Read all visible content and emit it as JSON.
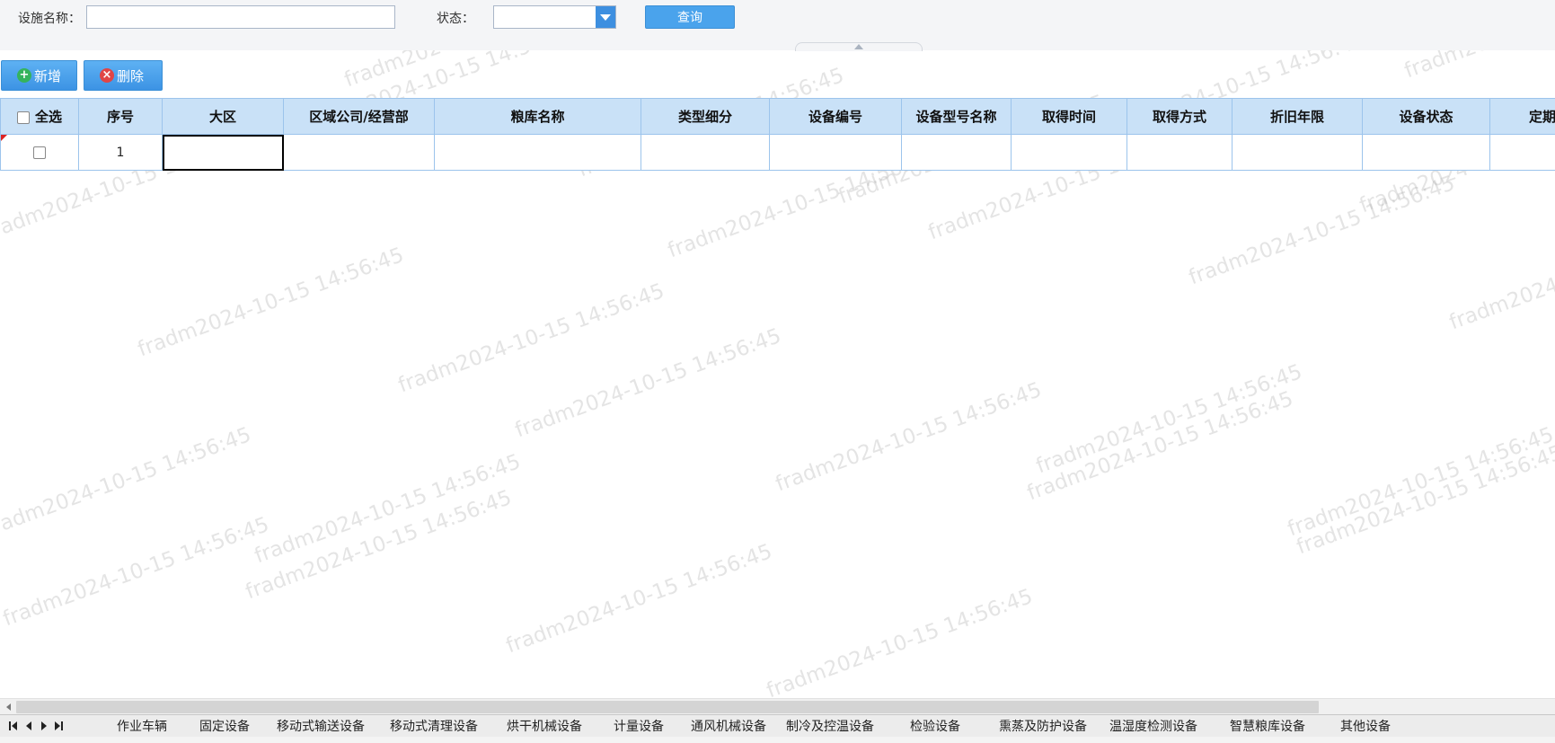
{
  "query": {
    "name_label": "设施名称：",
    "name_value": "",
    "status_label": "状态：",
    "status_value": "",
    "query_button": "查询"
  },
  "toolbar": {
    "add_label": "新增",
    "delete_label": "删除"
  },
  "grid": {
    "select_all_label": "全选",
    "columns": [
      "序号",
      "大区",
      "区域公司/经营部",
      "粮库名称",
      "类型细分",
      "设备编号",
      "设备型号名称",
      "取得时间",
      "取得方式",
      "折旧年限",
      "设备状态",
      "定期维"
    ],
    "rows": [
      [
        "1",
        "",
        "",
        "",
        "",
        "",
        "",
        "",
        "",
        "",
        "",
        ""
      ]
    ]
  },
  "watermark": "fradm2024-10-15 14:56:45",
  "sheet_tabs": [
    "作业车辆",
    "固定设备",
    "移动式输送设备",
    "移动式清理设备",
    "烘干机械设备",
    "计量设备",
    "通风机械设备",
    "制冷及控温设备",
    "检验设备",
    "熏蒸及防护设备",
    "温湿度检测设备",
    "智慧粮库设备",
    "其他设备"
  ],
  "active_sheet_tab": 0
}
